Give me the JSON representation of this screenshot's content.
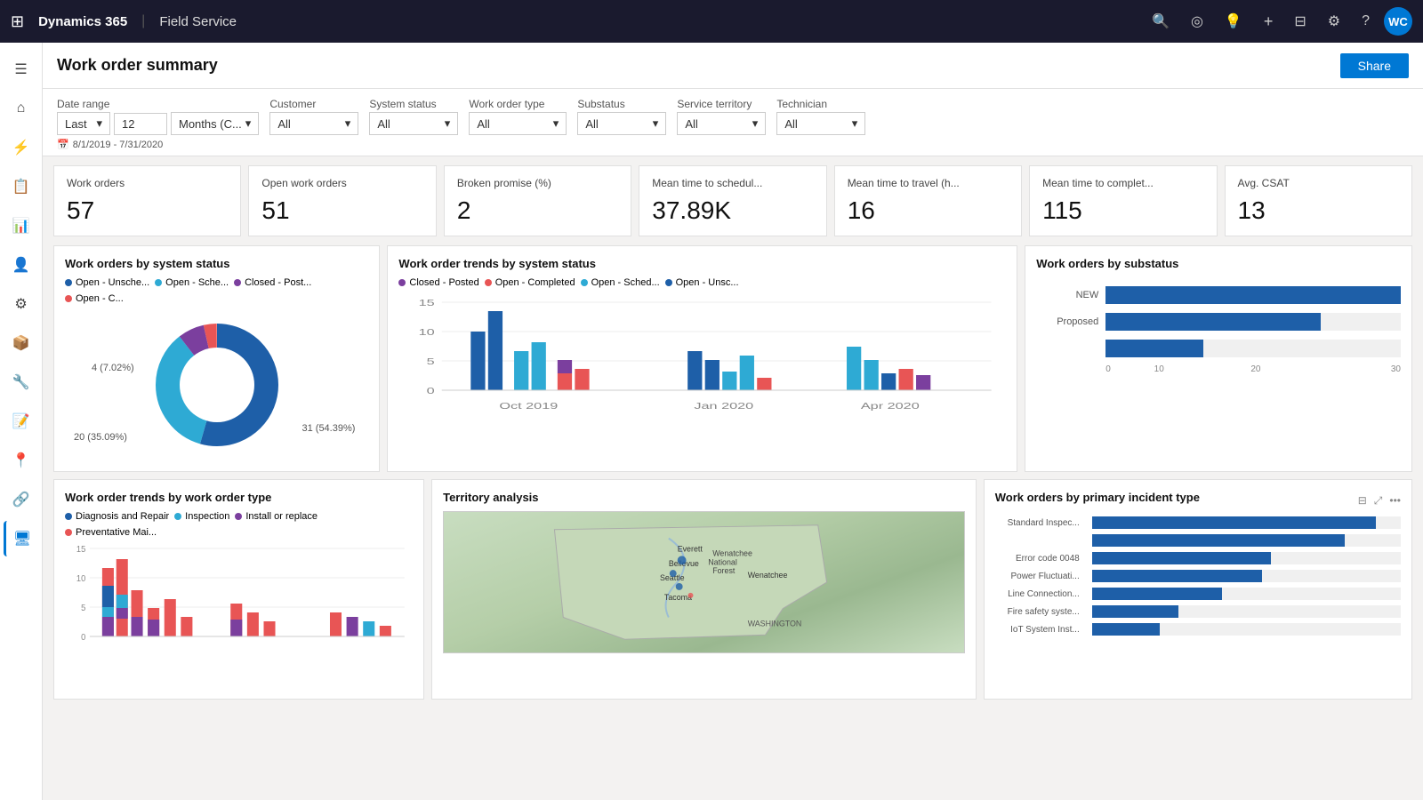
{
  "app": {
    "brand": "Dynamics 365",
    "divider": "|",
    "module": "Field Service"
  },
  "header": {
    "title": "Work order summary",
    "share_label": "Share"
  },
  "filters": {
    "date_range_label": "Date range",
    "date_range_preset": "Last",
    "date_range_num": "12",
    "date_range_unit": "Months (C...",
    "date_range_display": "8/1/2019 - 7/31/2020",
    "customer_label": "Customer",
    "customer_val": "All",
    "system_status_label": "System status",
    "system_status_val": "All",
    "work_order_type_label": "Work order type",
    "work_order_type_val": "All",
    "substatus_label": "Substatus",
    "substatus_val": "All",
    "service_territory_label": "Service territory",
    "service_territory_val": "All",
    "technician_label": "Technician",
    "technician_val": "All"
  },
  "kpis": [
    {
      "label": "Work orders",
      "value": "57"
    },
    {
      "label": "Open work orders",
      "value": "51"
    },
    {
      "label": "Broken promise (%)",
      "value": "2"
    },
    {
      "label": "Mean time to schedul...",
      "value": "37.89K"
    },
    {
      "label": "Mean time to travel (h...",
      "value": "16"
    },
    {
      "label": "Mean time to complet...",
      "value": "115"
    },
    {
      "label": "Avg. CSAT",
      "value": "13"
    }
  ],
  "donut_chart": {
    "title": "Work orders by system status",
    "legend": [
      {
        "label": "Open - Unsche...",
        "color": "#1e5fa8"
      },
      {
        "label": "Open - Sche...",
        "color": "#2eaad4"
      },
      {
        "label": "Closed - Post...",
        "color": "#7b3f9e"
      },
      {
        "label": "Open - C...",
        "color": "#e85555"
      }
    ],
    "segments": [
      {
        "value": 31,
        "pct": "54.39%",
        "color": "#1e5fa8"
      },
      {
        "value": 20,
        "pct": "35.09%",
        "color": "#2eaad4"
      },
      {
        "value": 4,
        "pct": "7.02%",
        "color": "#7b3f9e"
      },
      {
        "value": 2,
        "pct": "3.5%",
        "color": "#e85555"
      }
    ],
    "label_31": "31 (54.39%)",
    "label_20": "20 (35.09%)",
    "label_4": "4 (7.02%)"
  },
  "trend_chart": {
    "title": "Work order trends by system status",
    "legend": [
      {
        "label": "Closed - Posted",
        "color": "#7b3f9e"
      },
      {
        "label": "Open - Completed",
        "color": "#e85555"
      },
      {
        "label": "Open - Sched...",
        "color": "#2eaad4"
      },
      {
        "label": "Open - Unsc...",
        "color": "#1e5fa8"
      }
    ],
    "x_labels": [
      "Oct 2019",
      "Jan 2020",
      "Apr 2020"
    ],
    "y_labels": [
      "0",
      "5",
      "10",
      "15"
    ]
  },
  "substatus_chart": {
    "title": "Work orders by substatus",
    "bars": [
      {
        "label": "NEW",
        "value": 30,
        "max": 30
      },
      {
        "label": "Proposed",
        "value": 22,
        "max": 30
      },
      {
        "label": "",
        "value": 10,
        "max": 30
      }
    ],
    "x_labels": [
      "0",
      "10",
      "20",
      "30"
    ]
  },
  "work_order_type_chart": {
    "title": "Work order trends by work order type",
    "legend": [
      {
        "label": "Diagnosis and Repair",
        "color": "#1e5fa8"
      },
      {
        "label": "Inspection",
        "color": "#2eaad4"
      },
      {
        "label": "Install or replace",
        "color": "#7b3f9e"
      },
      {
        "label": "Preventative Mai...",
        "color": "#e85555"
      }
    ],
    "y_labels": [
      "0",
      "5",
      "10",
      "15"
    ]
  },
  "territory_chart": {
    "title": "Territory analysis"
  },
  "incident_chart": {
    "title": "Work orders by primary incident type",
    "bars": [
      {
        "label": "Standard Inspec...",
        "value": 92
      },
      {
        "label": "",
        "value": 82
      },
      {
        "label": "Error code 0048",
        "value": 58
      },
      {
        "label": "Power Fluctuati...",
        "value": 55
      },
      {
        "label": "Line Connection...",
        "value": 42
      },
      {
        "label": "Fire safety syste...",
        "value": 28
      },
      {
        "label": "IoT System Inst...",
        "value": 22
      }
    ],
    "max": 100
  },
  "sidebar": {
    "items": [
      {
        "icon": "☰",
        "name": "menu"
      },
      {
        "icon": "⌂",
        "name": "home"
      },
      {
        "icon": "⚡",
        "name": "activities"
      },
      {
        "icon": "📋",
        "name": "work-orders"
      },
      {
        "icon": "📊",
        "name": "dashboard"
      },
      {
        "icon": "👤",
        "name": "contacts"
      },
      {
        "icon": "⚙",
        "name": "settings"
      },
      {
        "icon": "📦",
        "name": "inventory"
      },
      {
        "icon": "🔧",
        "name": "resources"
      },
      {
        "icon": "📝",
        "name": "reports"
      },
      {
        "icon": "📍",
        "name": "location"
      },
      {
        "icon": "🔗",
        "name": "integrations"
      },
      {
        "icon": "🏷",
        "name": "tags"
      },
      {
        "icon": "💬",
        "name": "communications"
      }
    ]
  },
  "nav_icons": {
    "search": "🔍",
    "target": "🎯",
    "bulb": "💡",
    "plus": "+",
    "filter": "⊟",
    "settings": "⚙",
    "help": "?"
  },
  "avatar": {
    "initials": "WC"
  }
}
